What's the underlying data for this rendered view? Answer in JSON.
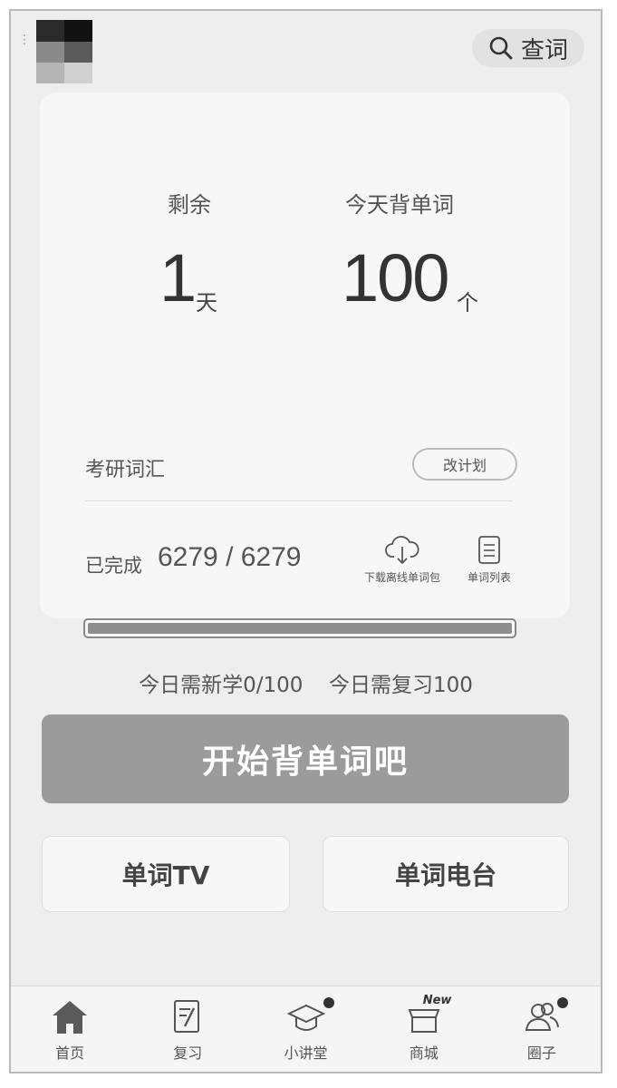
{
  "header": {
    "search_label": "查词"
  },
  "plan": {
    "remaining_label": "剩余",
    "remaining_value": "1",
    "remaining_unit": "天",
    "today_label": "今天背单词",
    "today_value": "100",
    "today_unit": "个",
    "vocab_name": "考研词汇",
    "change_plan_label": "改计划",
    "completed_label": "已完成",
    "completed_value": "6279 / 6279",
    "progress_fraction": 1.0,
    "download_label": "下载离线单词包",
    "word_list_label": "单词列表"
  },
  "today_summary": {
    "new_text": "今日需新学0/100",
    "review_text": "今日需复习100"
  },
  "actions": {
    "start_label": "开始背单词吧",
    "tv_label": "单词TV",
    "radio_label": "单词电台"
  },
  "tabbar": {
    "items": [
      {
        "label": "首页",
        "icon": "home-icon"
      },
      {
        "label": "复习",
        "icon": "review-icon"
      },
      {
        "label": "小讲堂",
        "icon": "graduation-cap-icon"
      },
      {
        "label": "商城",
        "icon": "shop-icon",
        "tag": "New"
      },
      {
        "label": "圈子",
        "icon": "people-icon"
      }
    ]
  }
}
